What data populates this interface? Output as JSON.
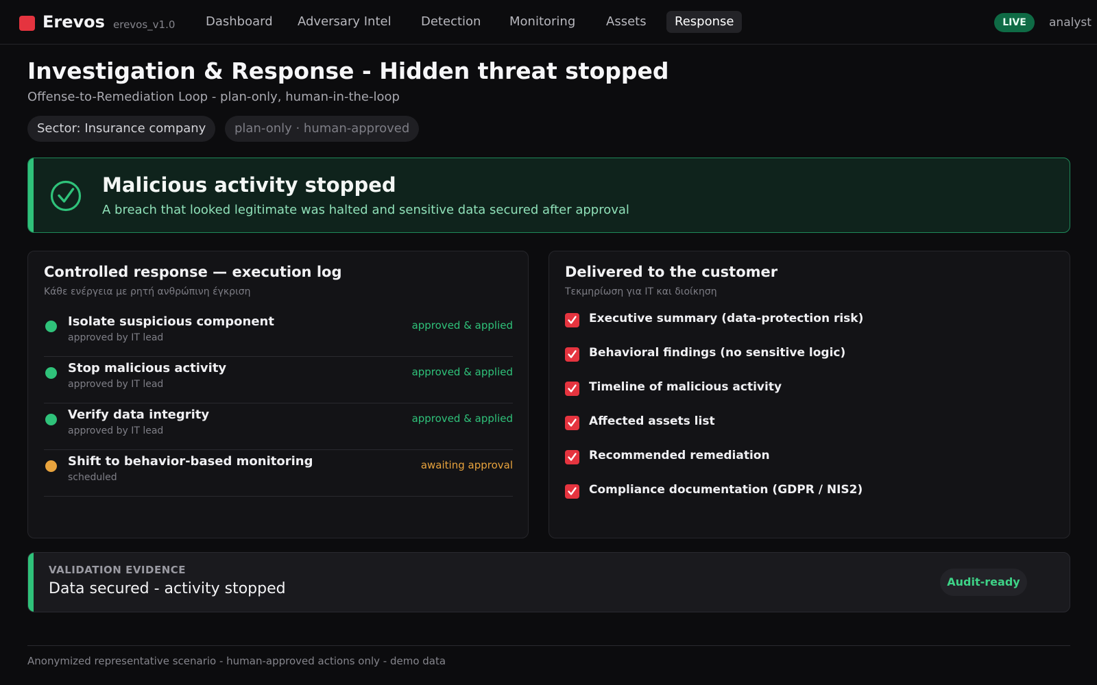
{
  "app": {
    "brand": "Erevos",
    "version": "erevos_v1.0",
    "live_label": "LIVE",
    "user": "analyst",
    "brand_color": "#e5343f"
  },
  "nav": {
    "items": [
      {
        "label": "Dashboard",
        "active": false
      },
      {
        "label": "Adversary Intel",
        "active": false
      },
      {
        "label": "Detection",
        "active": false
      },
      {
        "label": "Monitoring",
        "active": false
      },
      {
        "label": "Assets",
        "active": false
      },
      {
        "label": "Response",
        "active": true
      }
    ]
  },
  "header": {
    "title": "Investigation & Response - Hidden threat stopped",
    "subtitle": "Offense-to-Remediation Loop - plan-only, human-in-the-loop",
    "chips": {
      "sector": "Sector: Insurance company",
      "mode": "plan-only · human-approved"
    }
  },
  "banner": {
    "icon": "check-circle-icon",
    "title": "Malicious activity stopped",
    "text": "A breach that looked legitimate was halted and sensitive data secured after approval",
    "accent_color": "#2fc27a"
  },
  "execution_log": {
    "title": "Controlled response — execution log",
    "subtitle": "Κάθε ενέργεια με ρητή ανθρώπινη έγκριση",
    "rows": [
      {
        "name": "Isolate suspicious component",
        "by": "approved by IT lead",
        "status": "approved & applied",
        "color": "#2fc27a"
      },
      {
        "name": "Stop malicious activity",
        "by": "approved by IT lead",
        "status": "approved & applied",
        "color": "#2fc27a"
      },
      {
        "name": "Verify data integrity",
        "by": "approved by IT lead",
        "status": "approved & applied",
        "color": "#2fc27a"
      },
      {
        "name": "Shift to behavior-based monitoring",
        "by": "scheduled",
        "status": "awaiting approval",
        "color": "#e8a33d"
      }
    ]
  },
  "deliverables": {
    "title": "Delivered to the customer",
    "subtitle": "Τεκμηρίωση για IT και διοίκηση",
    "items": [
      {
        "label": "Executive summary (data-protection risk)"
      },
      {
        "label": "Behavioral findings (no sensitive logic)"
      },
      {
        "label": "Timeline of malicious activity"
      },
      {
        "label": "Affected assets list"
      },
      {
        "label": "Recommended remediation"
      },
      {
        "label": "Compliance documentation (GDPR / NIS2)"
      }
    ]
  },
  "evidence": {
    "label": "VALIDATION EVIDENCE",
    "value": "Data secured - activity stopped",
    "badge": "Audit-ready"
  },
  "footer": {
    "text": "Anonymized representative scenario - human-approved actions only - demo data"
  }
}
